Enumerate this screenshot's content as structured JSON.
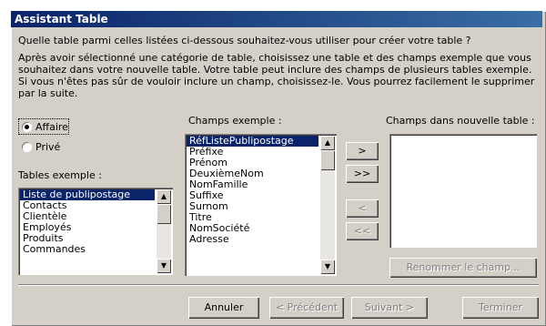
{
  "window": {
    "title": "Assistant Table"
  },
  "prompt": "Quelle table parmi celles listées ci-dessous souhaitez-vous utiliser pour créer votre table ?",
  "instructions": "Après avoir sélectionné une catégorie de table, choisissez une table et des champs exemple que vous souhaitez dans votre nouvelle table. Votre table peut inclure des champs de plusieurs tables exemple. Si vous n'êtes pas sûr de vouloir inclure un champ, choisissez-le. Vous pourrez facilement le supprimer par la suite.",
  "category": {
    "options": [
      "Affaire",
      "Privé"
    ],
    "selected": "Affaire"
  },
  "tables": {
    "label": "Tables exemple :",
    "items": [
      "Liste de publipostage",
      "Contacts",
      "Clientèle",
      "Employés",
      "Produits",
      "Commandes"
    ],
    "selected": "Liste de publipostage"
  },
  "fields": {
    "label": "Champs exemple :",
    "items": [
      "RéfListePublipostage",
      "Préfixe",
      "Prénom",
      "DeuxièmeNom",
      "NomFamille",
      "Suffixe",
      "Surnom",
      "Titre",
      "NomSociété",
      "Adresse"
    ],
    "selected": "RéfListePublipostage"
  },
  "new_fields": {
    "label": "Champs dans nouvelle table :",
    "items": []
  },
  "move_buttons": {
    "add_one": ">",
    "add_all": ">>",
    "remove_one": "<",
    "remove_all": "<<"
  },
  "rename_button": "Renommer le champ...",
  "footer": {
    "cancel": "Annuler",
    "previous": "< Précédent",
    "next": "Suivant >",
    "finish": "Terminer"
  },
  "icons": {
    "scroll_up": "scroll-up-arrow-icon",
    "scroll_down": "scroll-down-arrow-icon"
  }
}
